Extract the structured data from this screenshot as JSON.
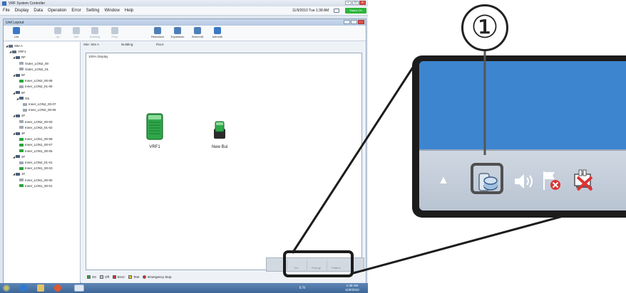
{
  "app": {
    "window_title": "VRF System Controller",
    "menu": [
      "File",
      "Display",
      "Data",
      "Operation",
      "Error",
      "Setting",
      "Window",
      "Help"
    ],
    "datetime": "11/9/2010 Tue 1:38 AM",
    "status_button": "Status On",
    "doc_title": "Unit Layout",
    "toolbar": [
      {
        "label": "List",
        "enabled": true
      },
      {
        "label": "Up",
        "enabled": false
      },
      {
        "label": "Site",
        "enabled": false
      },
      {
        "label": "Building",
        "enabled": false
      },
      {
        "label": "Floor",
        "enabled": false
      },
      {
        "label": "Reduction",
        "enabled": true
      },
      {
        "label": "Expansion",
        "enabled": true
      },
      {
        "label": "Select All",
        "enabled": true
      },
      {
        "label": "Azimuth",
        "enabled": true
      }
    ],
    "breadcrumb": {
      "site": "Site: Site A",
      "building": "Building:",
      "floor": "Floor:"
    },
    "zoom_label": "100% Display",
    "tree": [
      {
        "label": "Site A",
        "level": 0,
        "icon": "site",
        "expander": "◢"
      },
      {
        "label": "VRF1",
        "level": 1,
        "icon": "site",
        "expander": "◢"
      },
      {
        "label": "RF",
        "level": 2,
        "icon": "floor",
        "expander": "◢"
      },
      {
        "label": "Outer_LON2_00",
        "level": 3,
        "icon": "unit-gray",
        "expander": ""
      },
      {
        "label": "Outer_LON2_01",
        "level": 3,
        "icon": "unit-gray",
        "expander": ""
      },
      {
        "label": "6F",
        "level": 2,
        "icon": "floor",
        "expander": "◢"
      },
      {
        "label": "Inner_LON2_00-08",
        "level": 3,
        "icon": "unit-green",
        "expander": ""
      },
      {
        "label": "Inner_LON2_01-00",
        "level": 3,
        "icon": "unit-gray",
        "expander": ""
      },
      {
        "label": "5F",
        "level": 2,
        "icon": "floor",
        "expander": "◢"
      },
      {
        "label": "G5",
        "level": 3,
        "icon": "floor",
        "expander": "◢"
      },
      {
        "label": "Inner_LON2_00-07",
        "level": 4,
        "icon": "unit-gray",
        "expander": ""
      },
      {
        "label": "Inner_LON2_00-06",
        "level": 4,
        "icon": "unit-gray",
        "expander": ""
      },
      {
        "label": "4F",
        "level": 2,
        "icon": "floor",
        "expander": "◢"
      },
      {
        "label": "Inner_LON2_00-00",
        "level": 3,
        "icon": "unit-gray",
        "expander": ""
      },
      {
        "label": "Inner_LON2_01-02",
        "level": 3,
        "icon": "unit-gray",
        "expander": ""
      },
      {
        "label": "3F",
        "level": 2,
        "icon": "floor",
        "expander": "◢"
      },
      {
        "label": "Inner_LON1_00-08",
        "level": 3,
        "icon": "unit-green",
        "expander": ""
      },
      {
        "label": "Inner_LON1_00-07",
        "level": 3,
        "icon": "unit-green",
        "expander": ""
      },
      {
        "label": "Inner_LON1_00-05",
        "level": 3,
        "icon": "unit-green",
        "expander": ""
      },
      {
        "label": "2F",
        "level": 2,
        "icon": "floor",
        "expander": "◢"
      },
      {
        "label": "Inner_LON2_01-01",
        "level": 3,
        "icon": "unit-gray",
        "expander": ""
      },
      {
        "label": "Inner_LON1_00-03",
        "level": 3,
        "icon": "unit-green",
        "expander": ""
      },
      {
        "label": "1F",
        "level": 2,
        "icon": "floor",
        "expander": "◢"
      },
      {
        "label": "Inner_LON1_00-00",
        "level": 3,
        "icon": "unit-gray",
        "expander": ""
      },
      {
        "label": "Inner_LON1_00-01",
        "level": 3,
        "icon": "unit-green",
        "expander": ""
      }
    ],
    "units": [
      {
        "label": "VRF1",
        "color": "#2fa84a"
      },
      {
        "label": "New Bui",
        "color": "#2fa84a"
      }
    ],
    "legend": [
      {
        "label": "On",
        "color": "#2aa53c"
      },
      {
        "label": "Off",
        "color": "#c8c8c8"
      },
      {
        "label": "Error",
        "color": "#d02a2a"
      },
      {
        "label": "Test",
        "color": "#e8c21c"
      },
      {
        "label": "Emergency Stop",
        "color": "#d02a2a"
      }
    ],
    "mini_buttons": [
      "Clo",
      "Energy",
      "Pattern"
    ],
    "taskbar_tray": "EN",
    "taskbar_time": "1:38 AM",
    "taskbar_date": "11/9/2010"
  },
  "callout": {
    "number": "①"
  },
  "colors": {
    "desktop_blue": "#3d85cf",
    "callout_dark": "#1c1c1c",
    "highlight_gray": "#505050"
  }
}
